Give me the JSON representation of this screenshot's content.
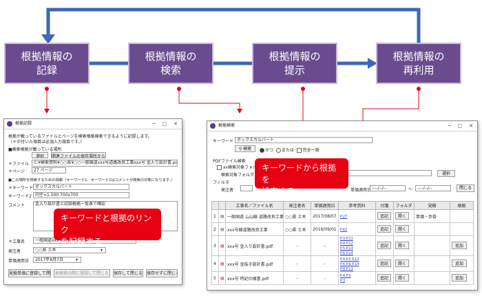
{
  "colors": {
    "flow_box": "#6a4b8e",
    "arrow": "#3f67b3",
    "callout": "#e60012",
    "connector": "#e60012"
  },
  "flow": {
    "steps": [
      "根拠情報の\n記録",
      "根拠情報の\n検索",
      "根拠情報の\n提示",
      "根拠情報の\n再利用"
    ]
  },
  "record_window": {
    "title": "根拠記録",
    "intro": [
      "根拠が載っているファイルとページを検索根拠検索できるように記録します。",
      "（＊が付いた項目は必須入力項目です。）"
    ],
    "section1": "■検索根拠が載っている場所",
    "select_button": "選択",
    "related_button": "関連ファイルの保存場所から選択",
    "file_label": "＊ファイル",
    "file_value": "C:¥検索資料¥○○県¥○○一般国道xxx号道路改良工事xxx号 金入り設計書.pdf",
    "page_label": "＊ページ",
    "page_value": "27 ページ",
    "section2": "■この場所を検索するための情報（キーワード1、キーワード2はコメントが検索の対象になります。）",
    "kw1_label": "＊キーワード1",
    "kw1_value": "ボックスカルバート",
    "kw2_label": "キーワード2",
    "kw2_value": "内空=1.500 700x700",
    "comment_label": "コメント",
    "comment_value": "金入り設計書と記録根拠一覧表で確認",
    "project_label": "＊工事名",
    "project_value": "一般国道xxx号道路改良工事",
    "client_label": "発注者",
    "client_value": "○○県  土木",
    "date_label": "単価適用日",
    "date_value": "2017年8月7日",
    "buttons": [
      "見積単価に登録して閉じる",
      "再検索の際に登録して閉じる",
      "保存して閉じる",
      "保存せずに閉じる"
    ]
  },
  "record_callout": "キーワードと根拠のリンク\nを記録する",
  "search_window": {
    "title": "根拠検索",
    "keyword_label": "キーワード",
    "keyword_value": "ボックスカルバート",
    "search_button": "検索",
    "mode_and": "かつ",
    "mode_or": "または",
    "mode_exact": "完全一致",
    "pdf_label": "PDFファイル検索",
    "pdf_option": "xx検索対象フォルダ",
    "target_label": "検索対象フォルダ",
    "select_button": "選択",
    "filter_label": "フィルタ",
    "client_label": "発注者",
    "date_label": "単価適用日",
    "date_from": "----/--/--",
    "date_sep": "～",
    "date_to": "----/--/--",
    "close_button": "閉じる",
    "columns": [
      "",
      "",
      "工事名／ファイル名",
      "発注者名",
      "単価適用日",
      "参考資料",
      "付箋",
      "フォルダ",
      "見積",
      "根拠"
    ],
    "rows": [
      {
        "num": "1",
        "name": "一般国道 ム山線 道路改良工事",
        "client": "○○県  土木",
        "date": "2017/08/07",
        "ref": "P.27",
        "memo": "追記",
        "folder": "開く",
        "estimate": "単価・歩掛",
        "basis": ""
      },
      {
        "num": "2",
        "name": "xxx号線道路改良工事",
        "client": "○○県  土木",
        "date": "2016/09/01",
        "ref": "P.62",
        "memo": "追記",
        "folder": "開く",
        "estimate": "",
        "basis": ""
      },
      {
        "num": "3",
        "name": "xxx号  金入り設計書.pdf",
        "client": "-",
        "date": "-",
        "ref": "P.3  P.11\nP.4  P.12\nP.5  P.13\nP.6  P.14",
        "memo": "追記",
        "folder": "開く",
        "estimate": "",
        "basis": "追加"
      },
      {
        "num": "4",
        "name": "xxx号  金抜き設計書.pdf",
        "client": "-",
        "date": "-",
        "ref": "P.4  P.5  P.13\nP.6  P.9  P.14\nP.8  P.11",
        "memo": "追記",
        "folder": "開く",
        "estimate": "",
        "basis": "追加"
      },
      {
        "num": "5",
        "name": "xxx号  特記仕様書.pdf",
        "client": "-",
        "date": "-",
        "ref": "P.4  P.5\nP.3",
        "memo": "追記",
        "folder": "開く",
        "estimate": "",
        "basis": "追加"
      }
    ]
  },
  "search_callout": "キーワードから根拠を\n検索する"
}
